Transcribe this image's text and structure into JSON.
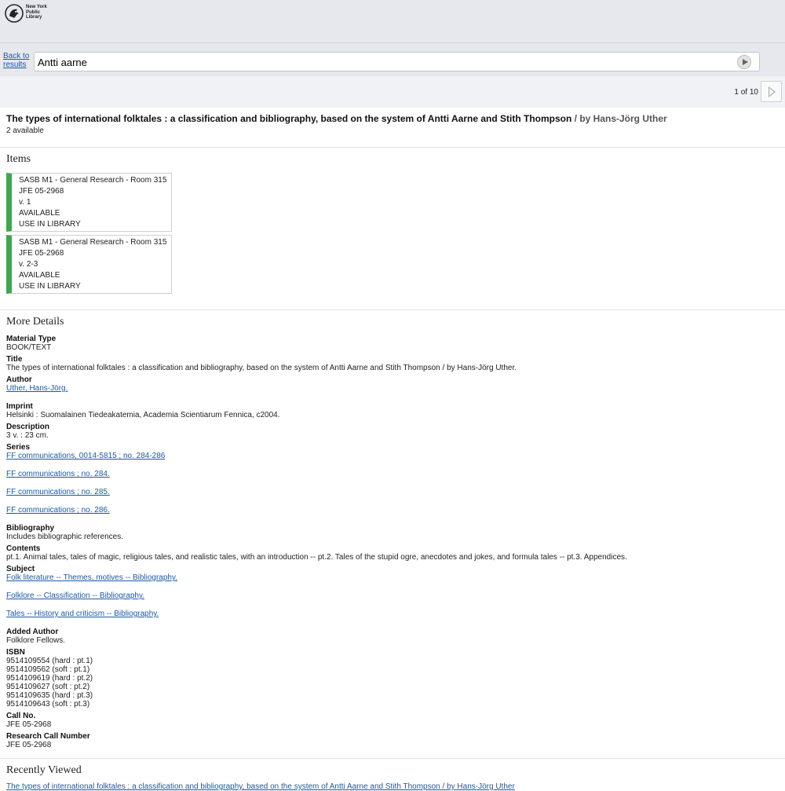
{
  "header": {
    "logo_lines": [
      "New York",
      "Public",
      "Library"
    ]
  },
  "search": {
    "back_label_1": "Back to",
    "back_label_2": "results",
    "value": "Antti aarne"
  },
  "pager": {
    "text": "1 of 10"
  },
  "record": {
    "title": "The types of international folktales : a classification and bibliography, based on the system of Antti Aarne and Stith Thompson",
    "byline": " / by Hans-Jörg Uther",
    "availability": "2 available"
  },
  "items_heading": "Items",
  "items": [
    {
      "location": "SASB M1 - General Research - Room 315",
      "call": "JFE 05-2968",
      "volume": "v. 1",
      "status": "AVAILABLE",
      "usage": "USE IN LIBRARY"
    },
    {
      "location": "SASB M1 - General Research - Room 315",
      "call": "JFE 05-2968",
      "volume": "v. 2-3",
      "status": "AVAILABLE",
      "usage": "USE IN LIBRARY"
    }
  ],
  "details_heading": "More Details",
  "details": {
    "material_type_label": "Material Type",
    "material_type": "BOOK/TEXT",
    "title_label": "Title",
    "title": "The types of international folktales : a classification and bibliography, based on the system of Antti Aarne and Stith Thompson / by Hans-Jörg Uther.",
    "author_label": "Author",
    "author": "Uther, Hans-Jörg.",
    "imprint_label": "Imprint",
    "imprint": "Helsinki : Suomalainen Tiedeakatemia, Academia Scientiarum Fennica, c2004.",
    "description_label": "Description",
    "description": "3 v. : 23 cm.",
    "series_label": "Series",
    "series": [
      "FF communications, 0014-5815 ; no. 284-286",
      "FF communications ; no. 284.",
      "FF communications ; no. 285.",
      "FF communications ; no. 286."
    ],
    "bibliography_label": "Bibliography",
    "bibliography": "Includes bibliographic references.",
    "contents_label": "Contents",
    "contents": "pt.1. Animal tales, tales of magic, religious tales, and realistic tales, with an introduction -- pt.2. Tales of the stupid ogre, anecdotes and jokes, and formula tales -- pt.3. Appendices.",
    "subject_label": "Subject",
    "subjects": [
      "Folk literature -- Themes, motives -- Bibliography.",
      "Folklore -- Classification -- Bibliography.",
      "Tales -- History and criticism -- Bibliography."
    ],
    "added_author_label": "Added Author",
    "added_author": "Folklore Fellows.",
    "isbn_label": "ISBN",
    "isbns": [
      "9514109554 (hard : pt.1)",
      "9514109562 (soft : pt.1)",
      "9514109619 (hard : pt.2)",
      "9514109627 (soft : pt.2)",
      "9514109635 (hard : pt.3)",
      "9514109643 (soft : pt.3)"
    ],
    "call_no_label": "Call No.",
    "call_no": "JFE 05-2968",
    "research_call_label": "Research Call Number",
    "research_call": "JFE 05-2968"
  },
  "recently_viewed_heading": "Recently Viewed",
  "recently_viewed_link": "The types of international folktales : a classification and bibliography, based on the system of Antti Aarne and Stith Thompson / by Hans-Jörg Uther"
}
